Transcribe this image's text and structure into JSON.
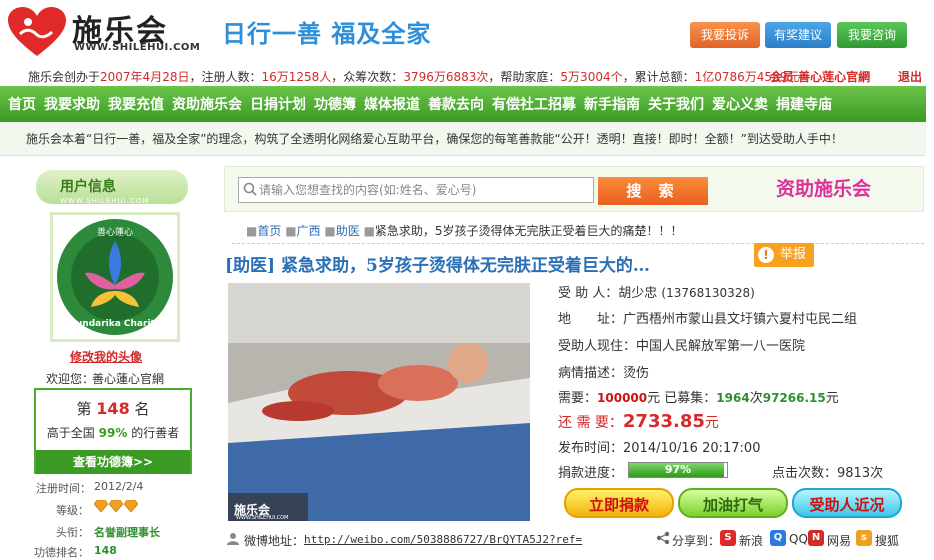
{
  "header": {
    "logo_text": "施乐会",
    "logo_url": "WWW.SHILEHUI.COM",
    "slogan": "日行一善 福及全家",
    "buttons": [
      "我要投诉",
      "有奖建议",
      "我要咨询"
    ]
  },
  "stats": {
    "p1": "施乐会创办于",
    "date": "2007年4月28日",
    "p2": "，注册人数：",
    "users": "16万1258人",
    "p3": "，众筹次数：",
    "crowd": "3796万6883次",
    "p4": "，帮助家庭：",
    "families": "5万3004个",
    "p5": "，累计总额：",
    "total": "1亿0786万4559元"
  },
  "user_link": "会员  善心莲心官網",
  "logout": "退出",
  "nav": [
    "首页",
    "我要求助",
    "我要充值",
    "资助施乐会",
    "日捐计划",
    "功德簿",
    "媒体报道",
    "善款去向",
    "有偿社工招募",
    "新手指南",
    "关于我们",
    "爱心义卖",
    "捐建寺庙"
  ],
  "notice": "施乐会本着“日行一善，福及全家”的理念，构筑了全透明化网络爱心互助平台，确保您的每笔善款能“公开！透明！直接！即时！全额！”到达受助人手中！",
  "sidebar": {
    "title": "用户信息",
    "url": "WWW.SHILEHUI.COM",
    "avatar_top_text": "善心蓮心",
    "avatar_bottom_text": "Pundarika Charity",
    "edit_avatar": "修改我的头像",
    "welcome_label": "欢迎您：",
    "welcome_name": "善心蓮心官網",
    "rank_prefix": "第",
    "rank": "148",
    "rank_suffix": "名",
    "pct_prefix": "高于全国",
    "pct": "99%",
    "pct_suffix": "的行善者",
    "merit_button": "查看功德簿>>",
    "reg_label": "注册时间：",
    "reg_date": "2012/2/4",
    "level_label": "等级：",
    "title_label": "头衔：",
    "title_value": "名誉副理事长",
    "merit_rank_label": "功德排名：",
    "merit_rank": "148"
  },
  "search": {
    "placeholder": "请输入您想查找的内容(如:姓名、爱心号)",
    "button": "搜 索"
  },
  "brand_text": "资助施乐会",
  "breadcrumb": [
    "首页",
    "广西",
    "助医",
    "紧急求助，5岁孩子烫得体无完肤正受着巨大的痛楚！！！"
  ],
  "post": {
    "title": "[助医] 紧急求助，5岁孩子烫得体无完肤正受着巨大的…",
    "report": "举报",
    "photo_watermark": "施乐会",
    "photo_url": "WWW.SHILEHUI.COM",
    "name_label": "受 助 人：",
    "name": "胡少忠",
    "phone": "(13768130328)",
    "addr_label": "地　　址：",
    "address": "广西梧州市蒙山县文圩镇六夏村屯民二组",
    "hosp_label": "受助人现住：",
    "hospital": "中国人民解放军第一八一医院",
    "ill_label": "病情描述：",
    "illness": "烫伤",
    "need_label": "需要：",
    "need": "100000",
    "yuan": "元",
    "raised_label": "已募集：",
    "raised_times": "1964",
    "ci": "次",
    "raised": "97266.15",
    "still_label": "还 需 要：",
    "still": "2733.85",
    "pub_label": "发布时间：",
    "pub_time": "2014/10/16 20:17:00",
    "progress_label": "捐款进度：",
    "progress": 97,
    "progress_text": "97%",
    "clicks_label": "点击次数：",
    "clicks": "9813次",
    "buttons": [
      "立即捐款",
      "加油打气",
      "受助人近况"
    ],
    "weibo_label": "微博地址：",
    "weibo_url": "http://weibo.com/5038886727/BrQYTA5J2?ref=",
    "share_label": "分享到：",
    "share": [
      "新浪",
      "QQ",
      "网易",
      "搜狐"
    ]
  },
  "colors": {
    "green": "#3a9a24",
    "red": "#d42a2a",
    "blue": "#2a6fb8",
    "orange": "#f7a21e"
  }
}
